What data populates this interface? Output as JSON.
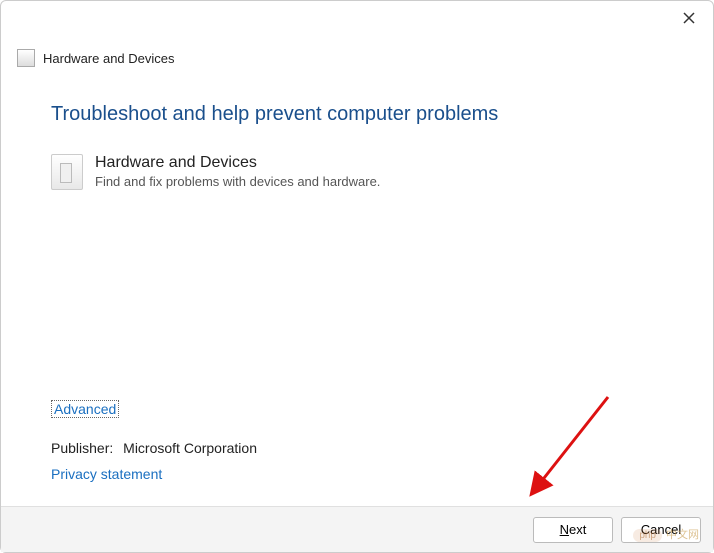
{
  "titlebar": {
    "close_tooltip": "Close"
  },
  "header": {
    "title": "Hardware and Devices"
  },
  "content": {
    "heading": "Troubleshoot and help prevent computer problems",
    "item": {
      "title": "Hardware and Devices",
      "description": "Find and fix problems with devices and hardware."
    }
  },
  "footer": {
    "advanced": "Advanced",
    "publisher_label": "Publisher:",
    "publisher_value": "Microsoft Corporation",
    "privacy": "Privacy statement"
  },
  "buttons": {
    "next_prefix": "N",
    "next_suffix": "ext",
    "cancel": "Cancel"
  },
  "watermark": {
    "badge": "php",
    "text": "中文网"
  }
}
